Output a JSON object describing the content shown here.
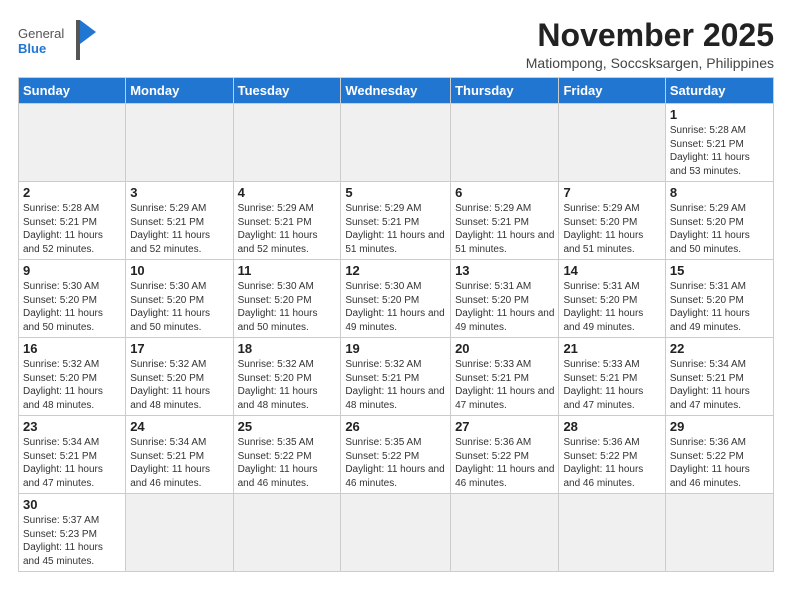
{
  "header": {
    "logo_general": "General",
    "logo_blue": "Blue",
    "month_year": "November 2025",
    "location": "Matiompong, Soccsksargen, Philippines"
  },
  "weekdays": [
    "Sunday",
    "Monday",
    "Tuesday",
    "Wednesday",
    "Thursday",
    "Friday",
    "Saturday"
  ],
  "weeks": [
    [
      {
        "day": "",
        "info": ""
      },
      {
        "day": "",
        "info": ""
      },
      {
        "day": "",
        "info": ""
      },
      {
        "day": "",
        "info": ""
      },
      {
        "day": "",
        "info": ""
      },
      {
        "day": "",
        "info": ""
      },
      {
        "day": "1",
        "info": "Sunrise: 5:28 AM\nSunset: 5:21 PM\nDaylight: 11 hours\nand 53 minutes."
      }
    ],
    [
      {
        "day": "2",
        "info": "Sunrise: 5:28 AM\nSunset: 5:21 PM\nDaylight: 11 hours\nand 52 minutes."
      },
      {
        "day": "3",
        "info": "Sunrise: 5:29 AM\nSunset: 5:21 PM\nDaylight: 11 hours\nand 52 minutes."
      },
      {
        "day": "4",
        "info": "Sunrise: 5:29 AM\nSunset: 5:21 PM\nDaylight: 11 hours\nand 52 minutes."
      },
      {
        "day": "5",
        "info": "Sunrise: 5:29 AM\nSunset: 5:21 PM\nDaylight: 11 hours\nand 51 minutes."
      },
      {
        "day": "6",
        "info": "Sunrise: 5:29 AM\nSunset: 5:21 PM\nDaylight: 11 hours\nand 51 minutes."
      },
      {
        "day": "7",
        "info": "Sunrise: 5:29 AM\nSunset: 5:20 PM\nDaylight: 11 hours\nand 51 minutes."
      },
      {
        "day": "8",
        "info": "Sunrise: 5:29 AM\nSunset: 5:20 PM\nDaylight: 11 hours\nand 50 minutes."
      }
    ],
    [
      {
        "day": "9",
        "info": "Sunrise: 5:30 AM\nSunset: 5:20 PM\nDaylight: 11 hours\nand 50 minutes."
      },
      {
        "day": "10",
        "info": "Sunrise: 5:30 AM\nSunset: 5:20 PM\nDaylight: 11 hours\nand 50 minutes."
      },
      {
        "day": "11",
        "info": "Sunrise: 5:30 AM\nSunset: 5:20 PM\nDaylight: 11 hours\nand 50 minutes."
      },
      {
        "day": "12",
        "info": "Sunrise: 5:30 AM\nSunset: 5:20 PM\nDaylight: 11 hours\nand 49 minutes."
      },
      {
        "day": "13",
        "info": "Sunrise: 5:31 AM\nSunset: 5:20 PM\nDaylight: 11 hours\nand 49 minutes."
      },
      {
        "day": "14",
        "info": "Sunrise: 5:31 AM\nSunset: 5:20 PM\nDaylight: 11 hours\nand 49 minutes."
      },
      {
        "day": "15",
        "info": "Sunrise: 5:31 AM\nSunset: 5:20 PM\nDaylight: 11 hours\nand 49 minutes."
      }
    ],
    [
      {
        "day": "16",
        "info": "Sunrise: 5:32 AM\nSunset: 5:20 PM\nDaylight: 11 hours\nand 48 minutes."
      },
      {
        "day": "17",
        "info": "Sunrise: 5:32 AM\nSunset: 5:20 PM\nDaylight: 11 hours\nand 48 minutes."
      },
      {
        "day": "18",
        "info": "Sunrise: 5:32 AM\nSunset: 5:20 PM\nDaylight: 11 hours\nand 48 minutes."
      },
      {
        "day": "19",
        "info": "Sunrise: 5:32 AM\nSunset: 5:21 PM\nDaylight: 11 hours\nand 48 minutes."
      },
      {
        "day": "20",
        "info": "Sunrise: 5:33 AM\nSunset: 5:21 PM\nDaylight: 11 hours\nand 47 minutes."
      },
      {
        "day": "21",
        "info": "Sunrise: 5:33 AM\nSunset: 5:21 PM\nDaylight: 11 hours\nand 47 minutes."
      },
      {
        "day": "22",
        "info": "Sunrise: 5:34 AM\nSunset: 5:21 PM\nDaylight: 11 hours\nand 47 minutes."
      }
    ],
    [
      {
        "day": "23",
        "info": "Sunrise: 5:34 AM\nSunset: 5:21 PM\nDaylight: 11 hours\nand 47 minutes."
      },
      {
        "day": "24",
        "info": "Sunrise: 5:34 AM\nSunset: 5:21 PM\nDaylight: 11 hours\nand 46 minutes."
      },
      {
        "day": "25",
        "info": "Sunrise: 5:35 AM\nSunset: 5:22 PM\nDaylight: 11 hours\nand 46 minutes."
      },
      {
        "day": "26",
        "info": "Sunrise: 5:35 AM\nSunset: 5:22 PM\nDaylight: 11 hours\nand 46 minutes."
      },
      {
        "day": "27",
        "info": "Sunrise: 5:36 AM\nSunset: 5:22 PM\nDaylight: 11 hours\nand 46 minutes."
      },
      {
        "day": "28",
        "info": "Sunrise: 5:36 AM\nSunset: 5:22 PM\nDaylight: 11 hours\nand 46 minutes."
      },
      {
        "day": "29",
        "info": "Sunrise: 5:36 AM\nSunset: 5:22 PM\nDaylight: 11 hours\nand 46 minutes."
      }
    ],
    [
      {
        "day": "30",
        "info": "Sunrise: 5:37 AM\nSunset: 5:23 PM\nDaylight: 11 hours\nand 45 minutes."
      },
      {
        "day": "",
        "info": ""
      },
      {
        "day": "",
        "info": ""
      },
      {
        "day": "",
        "info": ""
      },
      {
        "day": "",
        "info": ""
      },
      {
        "day": "",
        "info": ""
      },
      {
        "day": "",
        "info": ""
      }
    ]
  ]
}
